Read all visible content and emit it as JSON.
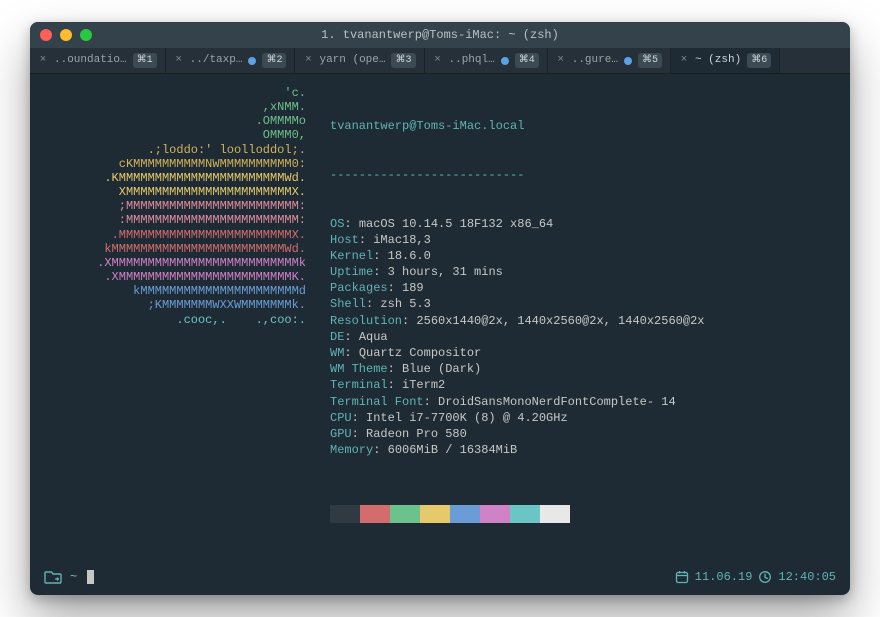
{
  "window": {
    "title": "1. tvanantwerp@Toms-iMac: ~ (zsh)"
  },
  "tabs": [
    {
      "label": "..oundatio…",
      "shortcut": "⌘1",
      "dot": false,
      "active": false
    },
    {
      "label": "../taxp…",
      "shortcut": "⌘2",
      "dot": true,
      "active": false
    },
    {
      "label": "yarn (ope…",
      "shortcut": "⌘3",
      "dot": false,
      "active": false
    },
    {
      "label": "..phql…",
      "shortcut": "⌘4",
      "dot": true,
      "active": false
    },
    {
      "label": "..gure…",
      "shortcut": "⌘5",
      "dot": true,
      "active": false
    },
    {
      "label": "~ (zsh)",
      "shortcut": "⌘6",
      "dot": false,
      "active": true
    }
  ],
  "ascii": {
    "lines": [
      {
        "t": "'c.",
        "c": "c-green"
      },
      {
        "t": ",xNMM.",
        "c": "c-green"
      },
      {
        "t": ".OMMMMo",
        "c": "c-green"
      },
      {
        "t": "OMMM0,",
        "c": "c-green"
      },
      {
        "t": ".;loddo:' loolloddol;.",
        "c": "c-gold"
      },
      {
        "t": "cKMMMMMMMMMMNWMMMMMMMMMM0:",
        "c": "c-gold"
      },
      {
        "t": ".KMMMMMMMMMMMMMMMMMMMMMMMWd.",
        "c": "c-yellow"
      },
      {
        "t": "XMMMMMMMMMMMMMMMMMMMMMMMX.",
        "c": "c-yellow"
      },
      {
        "t": ";MMMMMMMMMMMMMMMMMMMMMMMM:",
        "c": "c-pink"
      },
      {
        "t": ":MMMMMMMMMMMMMMMMMMMMMMMM:",
        "c": "c-pink"
      },
      {
        "t": ".MMMMMMMMMMMMMMMMMMMMMMMMX.",
        "c": "c-red"
      },
      {
        "t": "kMMMMMMMMMMMMMMMMMMMMMMMMWd.",
        "c": "c-red"
      },
      {
        "t": ".XMMMMMMMMMMMMMMMMMMMMMMMMMMk",
        "c": "c-magenta"
      },
      {
        "t": ".XMMMMMMMMMMMMMMMMMMMMMMMMK.",
        "c": "c-magenta"
      },
      {
        "t": "kMMMMMMMMMMMMMMMMMMMMMMd",
        "c": "c-blue"
      },
      {
        "t": ";KMMMMMMMWXXWMMMMMMMk.",
        "c": "c-blue"
      },
      {
        "t": ".cooc,.    .,coo:.",
        "c": "c-cyan"
      }
    ]
  },
  "neofetch": {
    "header": "tvanantwerp@Toms-iMac.local",
    "rule": "---------------------------",
    "rows": [
      {
        "k": "OS",
        "v": "macOS 10.14.5 18F132 x86_64"
      },
      {
        "k": "Host",
        "v": "iMac18,3"
      },
      {
        "k": "Kernel",
        "v": "18.6.0"
      },
      {
        "k": "Uptime",
        "v": "3 hours, 31 mins"
      },
      {
        "k": "Packages",
        "v": "189"
      },
      {
        "k": "Shell",
        "v": "zsh 5.3"
      },
      {
        "k": "Resolution",
        "v": "2560x1440@2x, 1440x2560@2x, 1440x2560@2x"
      },
      {
        "k": "DE",
        "v": "Aqua"
      },
      {
        "k": "WM",
        "v": "Quartz Compositor"
      },
      {
        "k": "WM Theme",
        "v": "Blue (Dark)"
      },
      {
        "k": "Terminal",
        "v": "iTerm2"
      },
      {
        "k": "Terminal Font",
        "v": "DroidSansMonoNerdFontComplete- 14"
      },
      {
        "k": "CPU",
        "v": "Intel i7-7700K (8) @ 4.20GHz"
      },
      {
        "k": "GPU",
        "v": "Radeon Pro 580"
      },
      {
        "k": "Memory",
        "v": "6006MiB / 16384MiB"
      }
    ],
    "swatches": [
      "#2f3a42",
      "#d36d6d",
      "#6cc28c",
      "#e6c96a",
      "#6a9dd8",
      "#cf82c6",
      "#6bc5c5",
      "#e8e8e8"
    ]
  },
  "status": {
    "cwd": "~",
    "date": "11.06.19",
    "time": "12:40:05"
  }
}
